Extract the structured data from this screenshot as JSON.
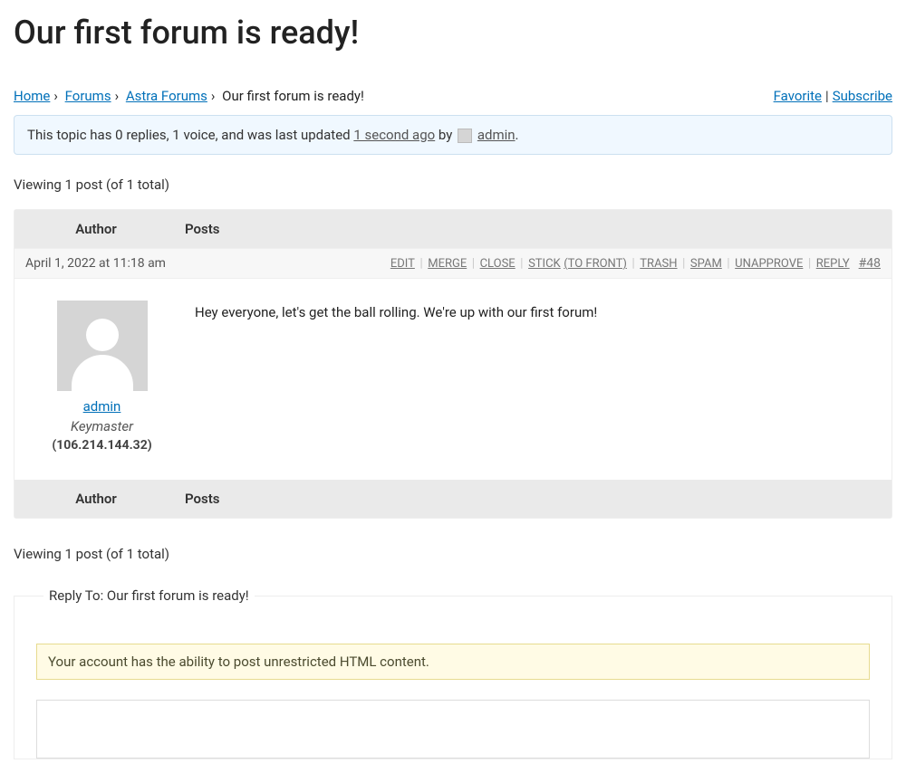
{
  "title": "Our first forum is ready!",
  "breadcrumb": {
    "home": "Home",
    "forums": "Forums",
    "astra": "Astra Forums",
    "current": "Our first forum is ready!"
  },
  "topicActions": {
    "favorite": "Favorite",
    "subscribe": "Subscribe"
  },
  "notice": {
    "prefix": "This topic has 0 replies, 1 voice, and was last updated ",
    "timeago": "1 second ago",
    "by": " by ",
    "user": "admin",
    "suffix": "."
  },
  "viewing": "Viewing 1 post (of 1 total)",
  "headers": {
    "author": "Author",
    "posts": "Posts"
  },
  "post": {
    "date": "April 1, 2022 at 11:18 am",
    "adminLinks": {
      "edit": "EDIT",
      "merge": "MERGE",
      "close": "CLOSE",
      "stick": "STICK",
      "toFront": "(TO FRONT)",
      "trash": "TRASH",
      "spam": "SPAM",
      "unapprove": "UNAPPROVE",
      "reply": "REPLY"
    },
    "number": "#48",
    "author": {
      "name": "admin",
      "role": "Keymaster",
      "ip": "(106.214.144.32)"
    },
    "content": "Hey everyone, let's get the ball rolling. We're up with our first forum!"
  },
  "replyForm": {
    "legend": "Reply To: Our first forum is ready!",
    "htmlNotice": "Your account has the ability to post unrestricted HTML content."
  }
}
